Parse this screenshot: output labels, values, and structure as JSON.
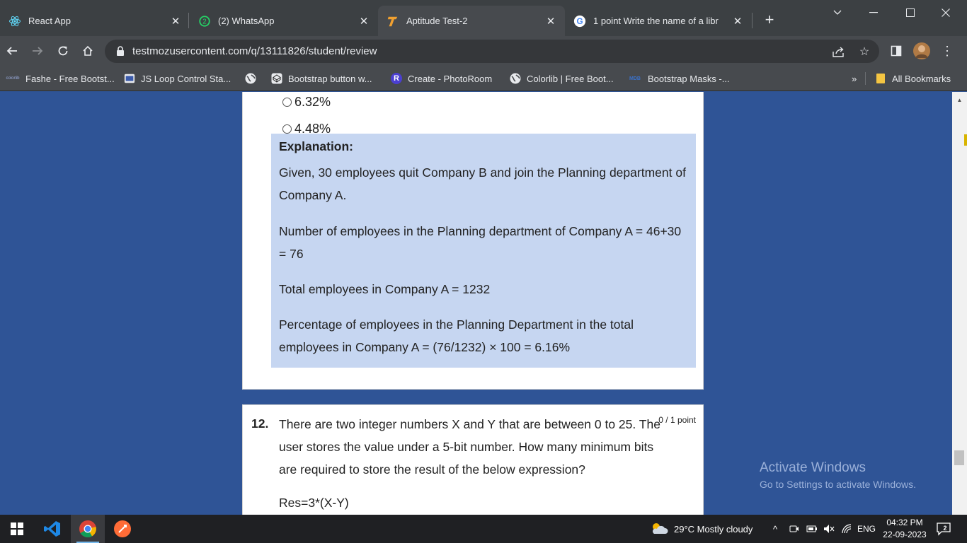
{
  "browser": {
    "tabs": [
      {
        "title": "React App",
        "icon": "react-icon"
      },
      {
        "title": "(2) WhatsApp",
        "icon": "whatsapp-icon",
        "badge": "2"
      },
      {
        "title": "Aptitude Test-2",
        "icon": "testmoz-icon"
      },
      {
        "title": "1 point Write the name of a libr",
        "icon": "google-icon"
      }
    ],
    "url": "testmozusercontent.com/q/13111826/student/review",
    "bookmarks": [
      {
        "label": "Fashe - Free Bootst...",
        "icon": "colorlib-icon",
        "icon_text": "colorlib"
      },
      {
        "label": "JS Loop Control Sta...",
        "icon": "page-icon"
      },
      {
        "label": "",
        "icon": "globe-icon"
      },
      {
        "label": "Bootstrap button w...",
        "icon": "codepen-icon"
      },
      {
        "label": "Create - PhotoRoom",
        "icon": "photoroom-icon",
        "icon_text": "R"
      },
      {
        "label": "Colorlib | Free Boot...",
        "icon": "globe-icon"
      },
      {
        "label": "Bootstrap Masks -...",
        "icon": "mdb-icon",
        "icon_text": "MDB"
      }
    ],
    "bookmarks_overflow": "»",
    "all_bookmarks": "All Bookmarks"
  },
  "question11": {
    "options": [
      "6.32%",
      "4.48%"
    ],
    "explanation_title": "Explanation:",
    "paragraphs": [
      "Given, 30 employees quit Company B and join the Planning department of Company A.",
      "Number of employees in the Planning department of Company A = 46+30 = 76",
      "Total employees in Company A = 1232",
      "Percentage of employees in the Planning Department in the total employees in Company A = (76/1232) × 100 = 6.16%"
    ]
  },
  "question12": {
    "number": "12.",
    "points": "0 / 1 point",
    "text": "There are two integer numbers X and Y that are between 0 to 25. The user stores the value under a 5-bit number. How many minimum bits are required to store the result of the below expression?",
    "expression": "Res=3*(X-Y)"
  },
  "watermark": {
    "title": "Activate Windows",
    "subtitle": "Go to Settings to activate Windows."
  },
  "taskbar": {
    "weather": "29°C  Mostly cloudy",
    "language": "ENG",
    "time": "04:32 PM",
    "date": "22-09-2023",
    "notification_count": "2"
  },
  "colors": {
    "page_background": "#2f5496",
    "explanation_background": "#c6d6f1",
    "browser_frame": "#3c4043",
    "toolbar": "#474a4e"
  }
}
